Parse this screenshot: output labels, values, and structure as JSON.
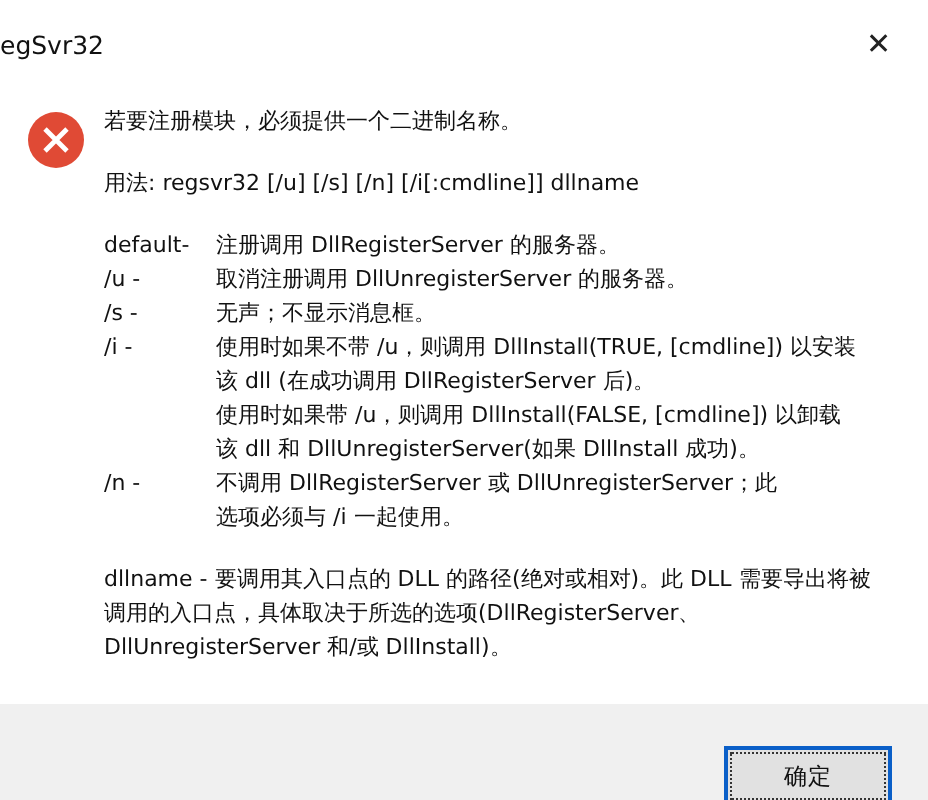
{
  "window": {
    "title": "egSvr32",
    "close": "✕"
  },
  "message": {
    "heading": "若要注册模块，必须提供一个二进制名称。",
    "usage": "用法: regsvr32 [/u] [/s] [/n] [/i[:cmdline]] dllname",
    "options": [
      {
        "key": "default-",
        "lines": [
          "注册调用 DllRegisterServer 的服务器。"
        ]
      },
      {
        "key": "/u -",
        "lines": [
          "取消注册调用 DllUnregisterServer 的服务器。"
        ]
      },
      {
        "key": "/s -",
        "lines": [
          "无声；不显示消息框。"
        ]
      },
      {
        "key": "/i -",
        "lines": [
          "使用时如果不带 /u，则调用 DllInstall(TRUE, [cmdline]) 以安装",
          "该 dll (在成功调用 DllRegisterServer 后)。",
          "使用时如果带 /u，则调用 DllInstall(FALSE, [cmdline]) 以卸载",
          "该 dll 和 DllUnregisterServer(如果 DllInstall 成功)。"
        ]
      },
      {
        "key": "/n -",
        "lines": [
          "不调用 DllRegisterServer 或 DllUnregisterServer；此",
          "选项必须与 /i 一起使用。"
        ]
      }
    ],
    "note": [
      "dllname - 要调用其入口点的 DLL 的路径(绝对或相对)。此 DLL 需要导出将被",
      "调用的入口点，具体取决于所选的选项(DllRegisterServer、",
      "DllUnregisterServer 和/或 DllInstall)。"
    ]
  },
  "buttons": [
    {
      "label": "确定",
      "focused": true
    }
  ]
}
